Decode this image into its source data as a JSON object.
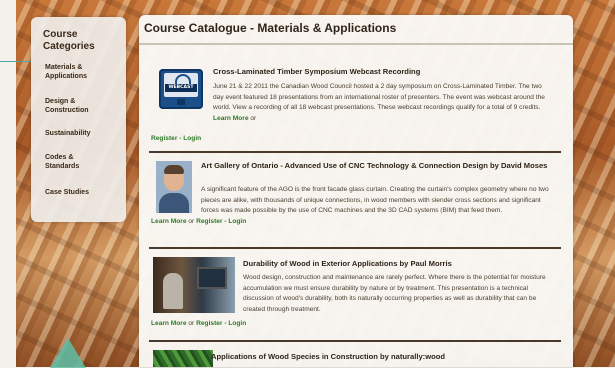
{
  "sidebar": {
    "heading": "Course\nCategories",
    "items": [
      {
        "label": "Materials &\nApplications"
      },
      {
        "label": "Design &\nConstruction"
      },
      {
        "label": "Sustainability"
      },
      {
        "label": "Codes &\nStandards"
      },
      {
        "label": "Case Studies"
      }
    ]
  },
  "main": {
    "title": "Course Catalogue - Materials & Applications",
    "courses": [
      {
        "title": "Cross-Laminated Timber Symposium Webcast Recording",
        "description": "June 21 & 22 2011 the Canadian Wood Council hosted a 2 day symposium on Cross-Laminated Timber. The two day event featured 18 presentations from an international roster of presenters. The event was webcast around the world. View a recording of all 18 webcast presentations. These webcast recordings qualify for a total of 9 credits.",
        "icon_label": "WEBCAST",
        "learn_more": "Learn More",
        "or": "or",
        "register": "Register - Login"
      },
      {
        "title": "Art Gallery of Ontario - Advanced Use of CNC Technology & Connection Design by David Moses",
        "description": "A significant feature of the AGO is the front facade glass curtain. Creating the curtain's complex geometry where no two pieces are alike, with thousands of unique connections, in wood members with slender cross sections and significant forces was made possible by the use of CNC machines and the 3D CAD systems (BIM) that feed them.",
        "learn_more": "Learn More",
        "or": "or",
        "register": "Register - Login"
      },
      {
        "title": "Durability of Wood in Exterior Applications by Paul Morris",
        "description": "Wood design, construction and maintenance are rarely perfect. Where there is the potential for moisture accumulation we must ensure durability by nature or by treatment. This presentation is a technical discussion of wood's durability, both its naturally occurring properties as well as durability that can be created through treatment.",
        "learn_more": "Learn More",
        "or": "or",
        "register": "Register - Login"
      },
      {
        "title": "Applications of Wood Species in Construction by naturally:wood"
      }
    ]
  }
}
